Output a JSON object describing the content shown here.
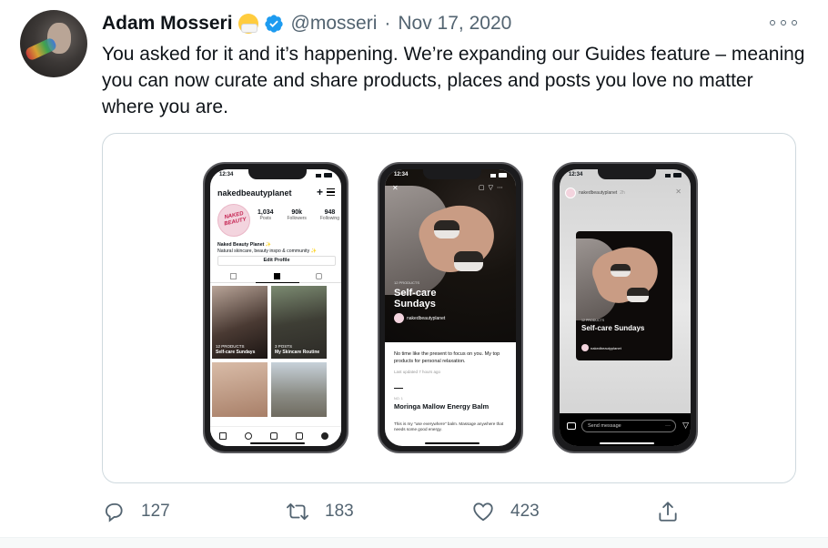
{
  "author": {
    "name": "Adam Mosseri",
    "handle": "@mosseri",
    "separator": "·",
    "date": "Nov 17, 2020",
    "emoji_icon": "mask-face-emoji",
    "verified_icon": "verified-badge-icon",
    "verified_color": "#1d9bf0"
  },
  "tweet": {
    "text": "You asked for it and it’s happening. We’re expanding our Guides feature – meaning you can now curate and share products, places and posts you love no matter where you are."
  },
  "media": {
    "phone1": {
      "time": "12:34",
      "account": "nakedbeautyplanet",
      "logo_text": "NAKED BEAUTY",
      "stats": [
        {
          "value": "1,034",
          "label": "Posts"
        },
        {
          "value": "90k",
          "label": "Followers"
        },
        {
          "value": "948",
          "label": "Following"
        }
      ],
      "bio_name": "Naked Beauty Planet ✨",
      "bio_text": "Natural skincare, beauty inspo & community ✨",
      "edit_profile": "Edit Profile",
      "tiles": [
        {
          "kicker": "12 PRODUCTS",
          "title": "Self-care Sundays"
        },
        {
          "kicker": "3 POSTS",
          "title": "My Skincare Routine"
        }
      ]
    },
    "phone2": {
      "time": "12:34",
      "kicker": "12 PRODUCTS",
      "title": "Self-care Sundays",
      "byline": "nakedbeautyplanet",
      "description": "No time like the present to focus on you. My top products for personal relaxation.",
      "updated": "Last updated 7 hours ago",
      "section": "NO. 1",
      "product_name": "Moringa Mallow Energy Balm",
      "product_desc": "This is my \"use everywhere\" balm. Massage anywhere that needs some good energy."
    },
    "phone3": {
      "time": "12:34",
      "account": "nakedbeautyplanet",
      "age": "2h",
      "kicker": "12 PRODUCTS",
      "title": "Self-care Sundays",
      "byline": "nakedbeautyplanet",
      "message_placeholder": "Send message"
    }
  },
  "actions": {
    "reply_count": "127",
    "retweet_count": "183",
    "like_count": "423"
  },
  "colors": {
    "text_primary": "#0f1419",
    "text_secondary": "#536471",
    "border": "#cfd9de"
  }
}
